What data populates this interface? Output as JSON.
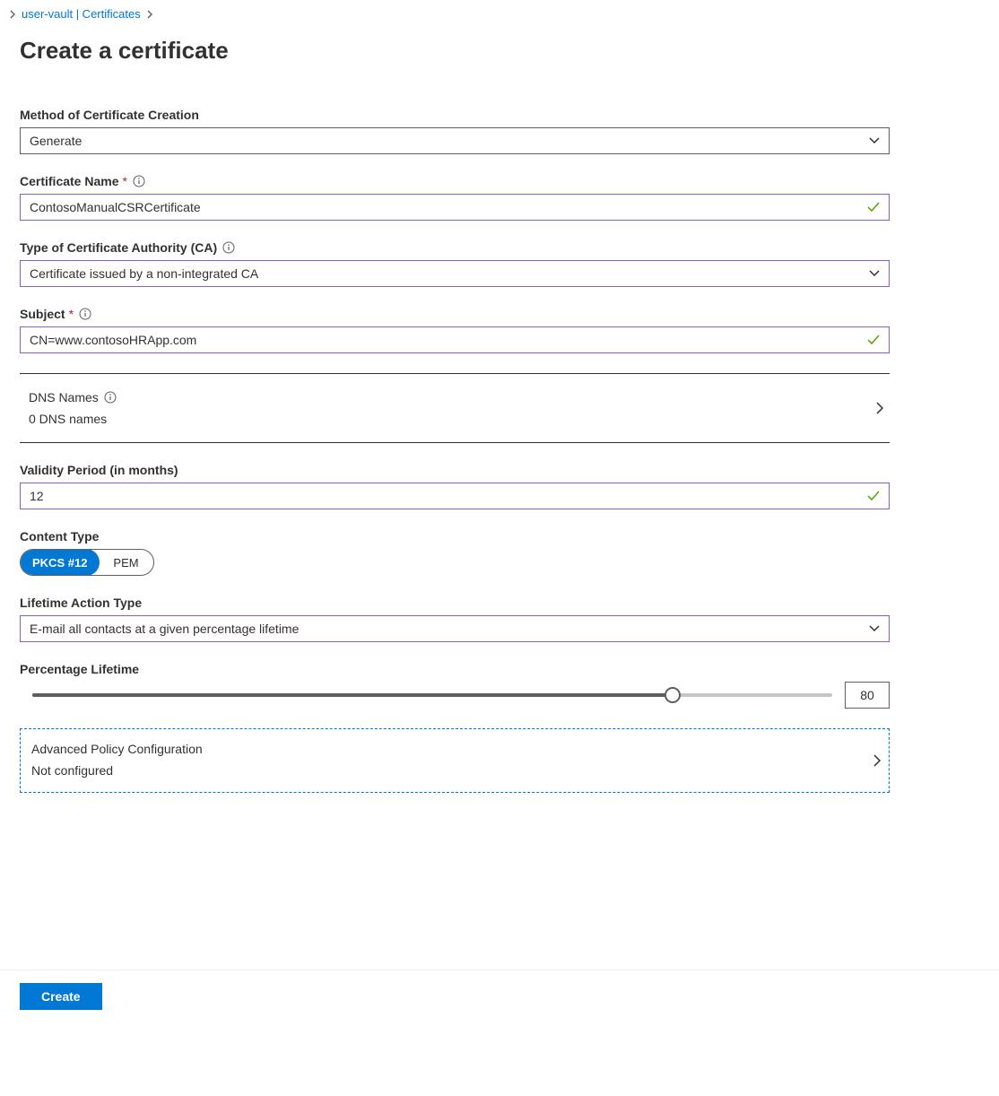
{
  "breadcrumb": {
    "segment": "user-vault | Certificates"
  },
  "page_title": "Create a certificate",
  "fields": {
    "method": {
      "label": "Method of Certificate Creation",
      "value": "Generate"
    },
    "cert_name": {
      "label": "Certificate Name",
      "value": "ContosoManualCSRCertificate"
    },
    "ca_type": {
      "label": "Type of Certificate Authority (CA)",
      "value": "Certificate issued by a non-integrated CA"
    },
    "subject": {
      "label": "Subject",
      "value": "CN=www.contosoHRApp.com"
    },
    "dns": {
      "label": "DNS Names",
      "value": "0 DNS names"
    },
    "validity": {
      "label": "Validity Period (in months)",
      "value": "12"
    },
    "content_type": {
      "label": "Content Type",
      "option_a": "PKCS #12",
      "option_b": "PEM"
    },
    "lifetime_action": {
      "label": "Lifetime Action Type",
      "value": "E-mail all contacts at a given percentage lifetime"
    },
    "percentage": {
      "label": "Percentage Lifetime",
      "value": "80"
    },
    "advanced": {
      "label": "Advanced Policy Configuration",
      "value": "Not configured"
    }
  },
  "buttons": {
    "create": "Create"
  }
}
